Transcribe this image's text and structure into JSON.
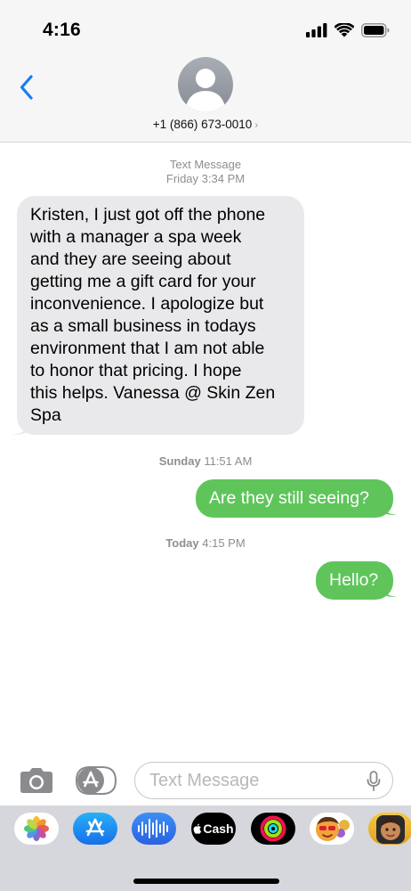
{
  "status_bar": {
    "time": "4:16",
    "icons": [
      "cellular-signal-icon",
      "wifi-icon",
      "battery-icon"
    ]
  },
  "header": {
    "back_icon": "chevron-left-icon",
    "avatar_icon": "person-icon",
    "contact": "+1 (866) 673-0010",
    "contact_chevron": "›"
  },
  "conversation": {
    "groups": [
      {
        "service": "Text Message",
        "day": "Friday",
        "time": "3:34 PM"
      },
      {
        "day": "Sunday",
        "time": "11:51 AM"
      },
      {
        "day": "Today",
        "time": "4:15 PM"
      }
    ],
    "messages": [
      {
        "direction": "incoming",
        "lines": [
          "Kristen, I just got off the phone",
          "with a manager a spa week",
          "and they are seeing about",
          "getting me a gift card for your",
          "inconvenience. I apologize but",
          "as a small business in todays",
          "environment that I am not able",
          "to honor that pricing. I hope",
          "this helps. Vanessa @ Skin Zen",
          "Spa"
        ]
      },
      {
        "direction": "outgoing",
        "text": "Are they still seeing?"
      },
      {
        "direction": "outgoing",
        "text": "Hello?"
      }
    ]
  },
  "input_bar": {
    "camera_icon": "camera-icon",
    "apps_icon": "app-store-icon",
    "placeholder": "Text Message",
    "mic_icon": "microphone-icon"
  },
  "app_drawer": {
    "apps": [
      {
        "name": "photos-app-icon"
      },
      {
        "name": "app-store-app-icon"
      },
      {
        "name": "audio-message-app-icon"
      },
      {
        "name": "apple-cash-app-icon",
        "label": "Cash",
        "logo": ""
      },
      {
        "name": "activity-app-icon"
      },
      {
        "name": "memoji-stickers-app-icon"
      },
      {
        "name": "memoji-app-icon"
      }
    ]
  },
  "colors": {
    "outgoing_bubble": "#5fc55b",
    "incoming_bubble": "#e9e9eb",
    "accent_blue": "#1a7cf5",
    "meta_text": "#8e8e93"
  }
}
